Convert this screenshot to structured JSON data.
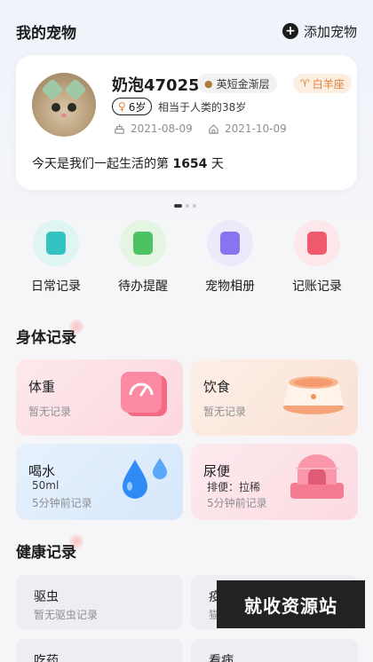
{
  "header": {
    "title": "我的宠物",
    "add_label": "添加宠物"
  },
  "pet": {
    "name": "奶泡47025",
    "breed": "英短金渐层",
    "zodiac": "白羊座",
    "age": "6岁",
    "human_age": "相当于人类的38岁",
    "birth_date": "2021-08-09",
    "home_date": "2021-10-09",
    "together_prefix": "今天是我们一起生活的第",
    "together_days": "1654",
    "together_suffix": "天"
  },
  "carousel": {
    "total": 3,
    "active": 0
  },
  "quick_actions": [
    {
      "label": "日常记录",
      "icon": "clipboard-icon",
      "bg": "#dff5f4",
      "fg": "#33c3c0"
    },
    {
      "label": "待办提醒",
      "icon": "todo-check-icon",
      "bg": "#e4f5e2",
      "fg": "#4cc263"
    },
    {
      "label": "宠物相册",
      "icon": "album-icon",
      "bg": "#ece9fb",
      "fg": "#8a73ee"
    },
    {
      "label": "记账记录",
      "icon": "ledger-icon",
      "bg": "#fde7ea",
      "fg": "#f05a6e"
    }
  ],
  "body_section": {
    "title": "身体记录"
  },
  "body_records": {
    "weight": {
      "title": "体重",
      "status": "暂无记录"
    },
    "diet": {
      "title": "饮食",
      "status": "暂无记录"
    },
    "water": {
      "title": "喝水",
      "value": "50ml",
      "time": "5分钟前记录"
    },
    "urine": {
      "title": "尿便",
      "value": "排便：拉稀",
      "time": "5分钟前记录"
    }
  },
  "health_section": {
    "title": "健康记录"
  },
  "health_records": {
    "deworm": {
      "title": "驱虫",
      "status": "暂无驱虫记录"
    },
    "vaccine_title_partial": "疫",
    "vaccine_sub_partial": "猫",
    "medicine": {
      "title": "吃药"
    },
    "vet": {
      "title": "看病"
    }
  },
  "watermark": "就收资源站",
  "colors": {
    "weight_bg": "#fde1e6",
    "diet_bg": "#fbe9e0",
    "water_bg": "#dfeefc",
    "urine_bg": "#fde3e8"
  }
}
